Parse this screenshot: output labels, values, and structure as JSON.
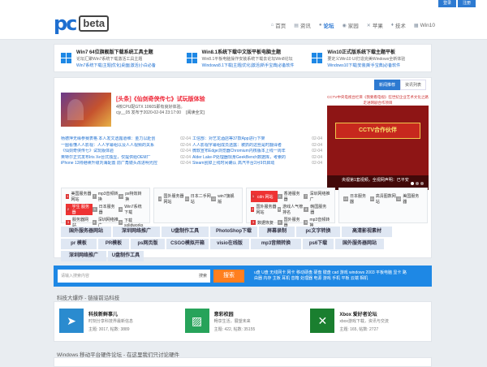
{
  "topbar": {
    "login": "登录",
    "register": "注册"
  },
  "logo": {
    "pc": "pc",
    "beta": "beta"
  },
  "nav": [
    {
      "icon": "home-icon",
      "glyph": "⌂",
      "label": "首页"
    },
    {
      "icon": "news-icon",
      "glyph": "▤",
      "label": "资讯"
    },
    {
      "icon": "forum-icon",
      "glyph": "●",
      "label": "论坛",
      "active": true
    },
    {
      "icon": "family-icon",
      "glyph": "◉",
      "label": "家园"
    },
    {
      "icon": "apple-icon",
      "glyph": "✕",
      "label": "苹果"
    },
    {
      "icon": "tech-icon",
      "glyph": "♦",
      "label": "技术"
    },
    {
      "icon": "windows-icon",
      "glyph": "▦",
      "label": "Win10"
    }
  ],
  "promos": [
    {
      "title": "Win7 64位旗舰版下载系统工具主题",
      "line1": "论坛汇聚Win7系统下载激活工具主题",
      "line2": "Win7系统下载|主题|优化|桌面|激活|小白必备"
    },
    {
      "title": "Win8.1系统下载中文版平板电脑主题",
      "line1": "Win8.1平板电脑操作安装系统下载去论坛Win8论坛",
      "line2": "Windows8.1下载|主题|优化|激活|新手宝典|必备软件"
    },
    {
      "title": "Win10正式版系统下载主题平板",
      "line1": "要定义Win10 UI打造完美Windows全新体验",
      "line2": "Windows10下载|安装|新手宝典|必备软件"
    }
  ],
  "tabs": [
    "新闻推荐",
    "资讯列表"
  ],
  "featured": {
    "headline": "[头条]《仙剑奇侠传七》试玩版体验",
    "desc1": "4核CPU配GTX 1060S即有良好体验。",
    "meta": "cjy__05 发布于2020-02-04 23:17:00",
    "read": "[阅读全文]"
  },
  "left_news": [
    {
      "t": "杨德萍无缘参赛表格 本人发文透露道维：金力以赴创",
      "d": "02-04"
    },
    {
      "t": "一图看懂人人影视：人人字幕组以及人人视频的关系",
      "d": "02-04"
    },
    {
      "t": "《仙剑奇侠传七》试玩版体验",
      "d": "02-04"
    },
    {
      "t": "英特尔正式发布Iris Xe台式独显，仅提供给OEM厂",
      "d": "02-04"
    },
    {
      "t": "iPhone 13将继续升级刘海配置 前广角镜头改进明光控",
      "d": "02-04"
    }
  ],
  "right_news": [
    {
      "t": "工信部：对艺龙酒店等37款App进行下架",
      "d": "02-04"
    },
    {
      "t": "人人影视字幕组成员透露：被抓的这些是时翻译者",
      "d": "02-04"
    },
    {
      "t": "微软宣布Edge浏览器Chromium内核版本上线一周年",
      "d": "02-04"
    },
    {
      "t": "Alder Lake-P处理器现身GeekBench数据库，考索的",
      "d": "02-04"
    },
    {
      "t": "Steam刮掉上线时间确认 高汽平台2月9日启动",
      "d": "02-04"
    }
  ],
  "banner": {
    "top": "CCTV中央电视台栏目《我要看电视》狂世纪企业艺术文化之路走进网剧合作项目",
    "mid": "CCTV合作伙伴",
    "caption": "央视第1套视频，全视网声明：已平安"
  },
  "boxes": [
    [
      {
        "n": "1",
        "t": "美国服务器网站"
      },
      {
        "n": "7",
        "t": "mp3音频转换"
      },
      {
        "n": "10",
        "t": "ps特效转换"
      },
      {
        "n": "2",
        "t": "学生 服务器",
        "hi": true
      },
      {
        "n": "5",
        "t": "日本服务器"
      },
      {
        "n": "8",
        "t": "Win7系统下载"
      },
      {
        "n": "3",
        "t": "服务器网站"
      },
      {
        "n": "6",
        "t": "深圳网络推广"
      },
      {
        "n": "9",
        "t": "下载solidworks"
      }
    ],
    [
      {
        "n": "4",
        "t": "国外服务器网站"
      },
      {
        "n": "11",
        "t": "日本二手网站"
      },
      {
        "n": "12",
        "t": "win7旗舰版"
      },
      {
        "n": "",
        "t": ""
      },
      {
        "n": "",
        "t": ""
      },
      {
        "n": "",
        "t": ""
      },
      {
        "n": "",
        "t": ""
      },
      {
        "n": "",
        "t": ""
      },
      {
        "n": "",
        "t": ""
      }
    ],
    [
      {
        "n": "1",
        "t": "cdn 网站",
        "hi": true
      },
      {
        "n": "4",
        "t": "香港服务器"
      },
      {
        "n": "7",
        "t": "深圳网络推广"
      },
      {
        "n": "2",
        "t": "国外服务器网站"
      },
      {
        "n": "5",
        "t": "游戏人气榜排名"
      },
      {
        "n": "8",
        "t": "韩国服务器"
      },
      {
        "n": "3",
        "t": "数据恢复"
      },
      {
        "n": "6",
        "t": "国外服务器"
      },
      {
        "n": "9",
        "t": "mp3音频转换"
      }
    ],
    [
      {
        "n": "10",
        "t": "日本服务器"
      },
      {
        "n": "11",
        "t": "高清图数网站"
      },
      {
        "n": "12",
        "t": "美国服务器"
      },
      {
        "n": "",
        "t": ""
      },
      {
        "n": "",
        "t": ""
      },
      {
        "n": "",
        "t": ""
      },
      {
        "n": "",
        "t": ""
      },
      {
        "n": "",
        "t": ""
      },
      {
        "n": "",
        "t": ""
      }
    ]
  ],
  "tags": [
    [
      "国外服务器网站",
      "深圳网络推广",
      "U盘制作工具",
      "PhotoShop下载",
      "屏幕录制",
      "pc文字转换",
      "高清影视素材",
      "pr 模板"
    ],
    [
      "PR模板",
      "ps网页版",
      "CSGO模拟开箱",
      "visio在线版",
      "mp3音频转换",
      "ps6下载",
      "国外服务器网站",
      "深圳网络推广",
      "U盘制作工具"
    ]
  ],
  "search": {
    "placeholder": "请输入搜索内容",
    "scope": "搜索",
    "button": "搜索",
    "keywords": "u盘 U盘 无线网卡 网卡 移动硬盘 硬盘 键盘 cad 游戏 windows 2003 平板电脑 显卡 路由器 内存 主板 耳机 音箱 处理器 电源 游戏 手机 平板 云端 相机"
  },
  "section1": "科技大爆炸 - 链接前沿科技",
  "cards": [
    {
      "icon": "telegram-icon",
      "glyph": "➤",
      "color": "#2a8bcf",
      "name": "科技新鲜事儿",
      "desc": "时刻分享科技界最新信息",
      "stat": "主题: 3017, 帖数: 3889"
    },
    {
      "icon": "image-icon",
      "glyph": "▨",
      "color": "#27a35a",
      "name": "意彩校园",
      "desc": "畅享生活，展望未来",
      "stat": "主题: 422, 帖数: 35155"
    },
    {
      "icon": "xbox-icon",
      "glyph": "✕",
      "color": "#1a7f2f",
      "name": "Xbox 爱好者论坛",
      "desc": "xbox游戏下载，资讯与交流",
      "stat": "主题: 165, 帖数: 2727"
    }
  ],
  "section2": "Windows 移动平台硬件论坛 - 在这里我们只讨论硬件"
}
